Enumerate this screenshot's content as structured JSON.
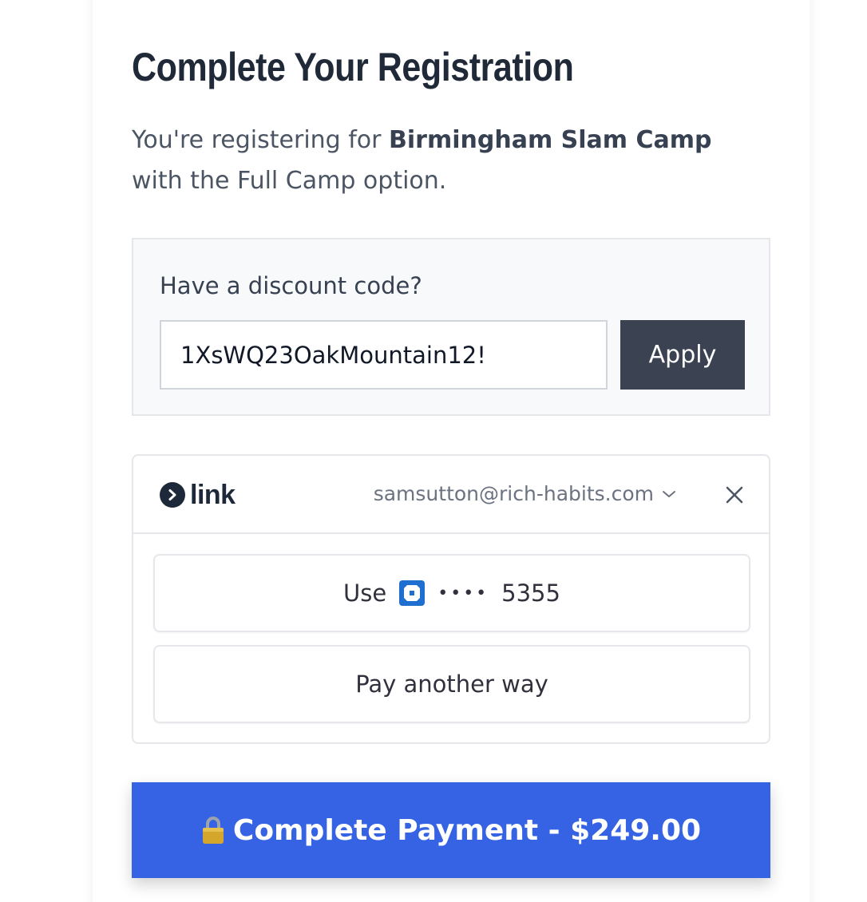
{
  "page": {
    "title": "Complete Your Registration",
    "subtitle_prefix": "You're registering for ",
    "camp_name": "Birmingham Slam Camp",
    "subtitle_suffix": " with the Full Camp option."
  },
  "discount": {
    "label": "Have a discount code?",
    "code_value": "1XsWQ23OakMountain12!",
    "apply_label": "Apply"
  },
  "link": {
    "brand": "link",
    "email": "samsutton@rich-habits.com",
    "icons": {
      "logo": "link-logo-icon",
      "dropdown": "chevron-down-icon",
      "close": "close-icon",
      "bank": "chase-bank-icon"
    },
    "use_prefix": "Use",
    "card_dots": "••••",
    "card_last4": "5355",
    "pay_another_way": "Pay another way"
  },
  "payment": {
    "button_label": "Complete Payment - $249.00",
    "icon": "lock-icon"
  },
  "colors": {
    "primary_button": "#3563e3",
    "apply_button": "#3b4252",
    "heading": "#1f2937",
    "bank_icon": "#1f6fd0"
  }
}
